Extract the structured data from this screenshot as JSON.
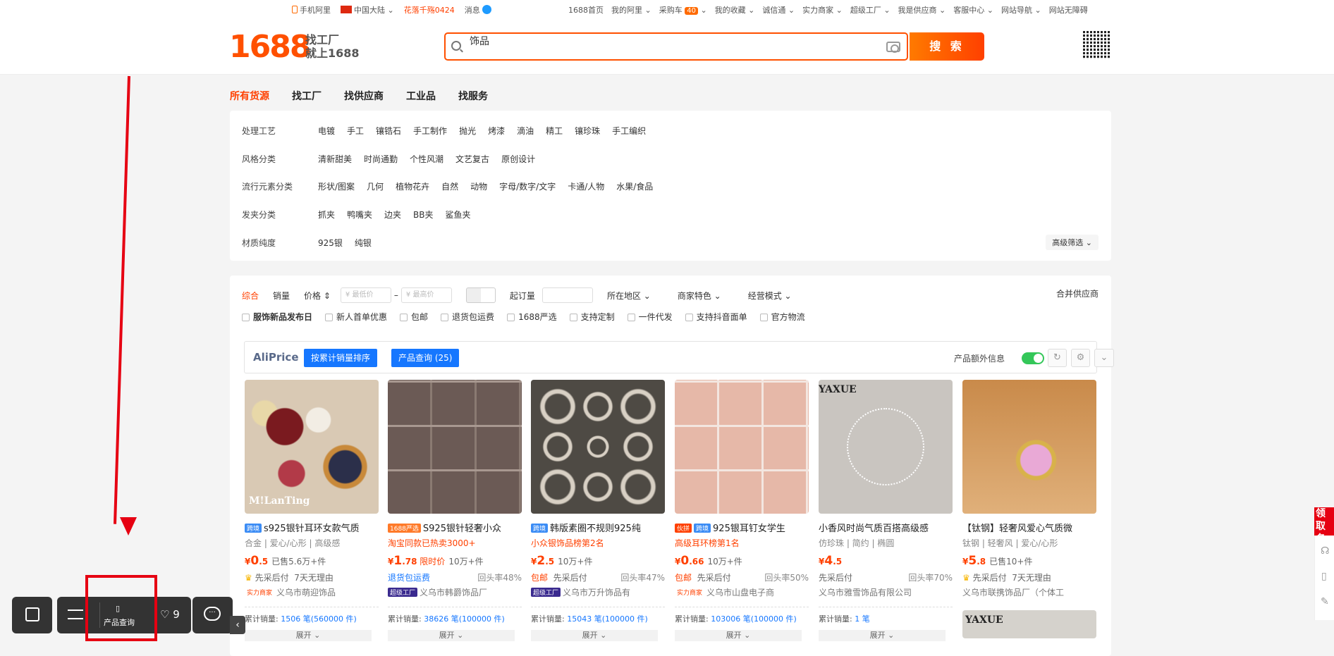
{
  "topbar": {
    "left": [
      "手机阿里",
      "中国大陆",
      "花落千殇0424",
      "消息"
    ],
    "right": [
      "1688首页",
      "我的阿里",
      "采购车",
      "我的收藏",
      "诚信通",
      "实力商家",
      "超级工厂",
      "我是供应商",
      "客服中心",
      "网站导航",
      "网站无障碍"
    ],
    "cart_count": "40"
  },
  "header": {
    "logo": "1688",
    "slogan1": "找工厂",
    "slogan2": "就上1688",
    "search_value": "饰品",
    "search_button": "搜 索"
  },
  "categories": [
    "所有货源",
    "找工厂",
    "找供应商",
    "工业品",
    "找服务"
  ],
  "filters": [
    {
      "label": "处理工艺",
      "values": [
        "电镀",
        "手工",
        "镶锆石",
        "手工制作",
        "抛光",
        "烤漆",
        "滴油",
        "精工",
        "镶珍珠",
        "手工编织"
      ]
    },
    {
      "label": "风格分类",
      "values": [
        "清新甜美",
        "时尚通勤",
        "个性风潮",
        "文艺复古",
        "原创设计"
      ]
    },
    {
      "label": "流行元素分类",
      "values": [
        "形状/图案",
        "几何",
        "植物花卉",
        "自然",
        "动物",
        "字母/数字/文字",
        "卡通/人物",
        "水果/食品"
      ]
    },
    {
      "label": "发夹分类",
      "values": [
        "抓夹",
        "鸭嘴夹",
        "边夹",
        "BB夹",
        "鲨鱼夹"
      ]
    },
    {
      "label": "材质纯度",
      "values": [
        "925银",
        "纯银"
      ]
    }
  ],
  "advanced_filter": "高级筛选",
  "sort": {
    "items": [
      "综合",
      "销量",
      "价格"
    ],
    "min_price_placeholder": "¥ 最低价",
    "max_price_placeholder": "¥ 最高价",
    "dash": "–",
    "moq": "起订量",
    "dropdowns": [
      "所在地区",
      "商家特色",
      "经营模式"
    ],
    "merge": "合并供应商"
  },
  "checkboxes": [
    "服饰新品发布日",
    "新人首单优惠",
    "包邮",
    "退货包运费",
    "1688严选",
    "支持定制",
    "一件代发",
    "支持抖音面单",
    "官方物流"
  ],
  "aliprice": {
    "brand": "AliPrice",
    "button1": "按累计销量排序",
    "button2": "产品查询 (25)",
    "extra_info": "产品额外信息",
    "extra_on": true
  },
  "products": [
    {
      "tag": "跨境",
      "tag_color": "#3b8cf5",
      "title": "s925银针耳环女款气质",
      "sub": "合金 | 爱心/心形 | 高级感",
      "sub_red": false,
      "price_int": "0",
      "price_dec": ".5",
      "price_note": "",
      "sold": "已售5.6万+件",
      "service_left": "先采后付",
      "service_left_blue": false,
      "service_right": "7天无理由",
      "shop_tag": "实力商家",
      "shop_tag_color": "#ff4000",
      "shop": "义乌市萌迎饰品",
      "cum_label": "累计销量:",
      "cum_value": "1506",
      "cum_unit": "笔(560000 件)",
      "expand": "展开"
    },
    {
      "tag": "1688严选",
      "tag_color": "#ff7a29",
      "title": "S925银针轻奢小众",
      "sub": "淘宝同款已热卖3000+",
      "sub_red": true,
      "price_int": "1",
      "price_dec": ".78",
      "price_note": "限时价",
      "sold": "10万+件",
      "service_left": "退货包运费",
      "service_left_blue": true,
      "service_right": "回头率48%",
      "shop_tag": "超级工厂",
      "shop_tag_color": "#3a2a8f",
      "shop": "义乌市韩爵饰品厂",
      "cum_label": "累计销量:",
      "cum_value": "38626",
      "cum_unit": "笔(100000 件)",
      "expand": "展开"
    },
    {
      "tag": "跨境",
      "tag_color": "#3b8cf5",
      "title": "韩版素圈不规则925纯",
      "sub": "小众银饰品榜第2名",
      "sub_red": true,
      "price_int": "2",
      "price_dec": ".5",
      "price_note": "",
      "sold": "10万+件",
      "service_left": "包邮",
      "service_left_blue": false,
      "service_right": "回头率47%",
      "shop_tag": "超级工厂",
      "shop_tag_color": "#3a2a8f",
      "shop": "义乌市万升饰品有",
      "cum_label": "累计销量:",
      "cum_value": "15043",
      "cum_unit": "笔(100000 件)",
      "expand": "展开"
    },
    {
      "tag": "伙拼",
      "tag_color": "#ff4000",
      "tag2": "跨境",
      "title": "925银耳钉女学生",
      "sub": "高级耳环榜第1名",
      "sub_red": true,
      "price_int": "0",
      "price_dec": ".66",
      "price_note": "",
      "sold": "10万+件",
      "service_left": "包邮",
      "service_left_blue": false,
      "service_right": "回头率50%",
      "shop_tag": "实力商家",
      "shop_tag_color": "#ff4000",
      "shop": "义乌市山盘电子商",
      "cum_label": "累计销量:",
      "cum_value": "103006",
      "cum_unit": "笔(100000 件)",
      "expand": "展开"
    },
    {
      "tag": "",
      "tag_color": "",
      "title": "小香风时尚气质百搭高级感",
      "sub": "仿珍珠 | 简约 | 椭圆",
      "sub_red": false,
      "price_int": "4",
      "price_dec": ".5",
      "price_note": "",
      "sold": "",
      "service_left": "先采后付",
      "service_left_blue": false,
      "service_right": "回头率70%",
      "shop_tag": "",
      "shop_tag_color": "",
      "shop": "义乌市雅雪饰品有限公司",
      "cum_label": "累计销量:",
      "cum_value": "1",
      "cum_unit": "笔",
      "expand": "展开",
      "img_label": "YAXUE"
    },
    {
      "tag": "",
      "tag_color": "",
      "title": "【钛钢】轻奢风爱心气质微",
      "sub": "钛钢 | 轻奢风 | 爱心/心形",
      "sub_red": false,
      "price_int": "5",
      "price_dec": ".8",
      "price_note": "",
      "sold": "已售10+件",
      "service_left": "先采后付",
      "service_left_blue": false,
      "service_right": "7天无理由",
      "shop_tag": "",
      "shop_tag_color": "",
      "shop": "义乌市联携饰品厂（个体工",
      "img_label": "",
      "extra_label": "YAXUE"
    }
  ],
  "first_img_text": "M!LanTing",
  "bottom_bar": {
    "query_label": "产品查询",
    "wish_count": "9"
  },
  "side_promo": "领取名片"
}
